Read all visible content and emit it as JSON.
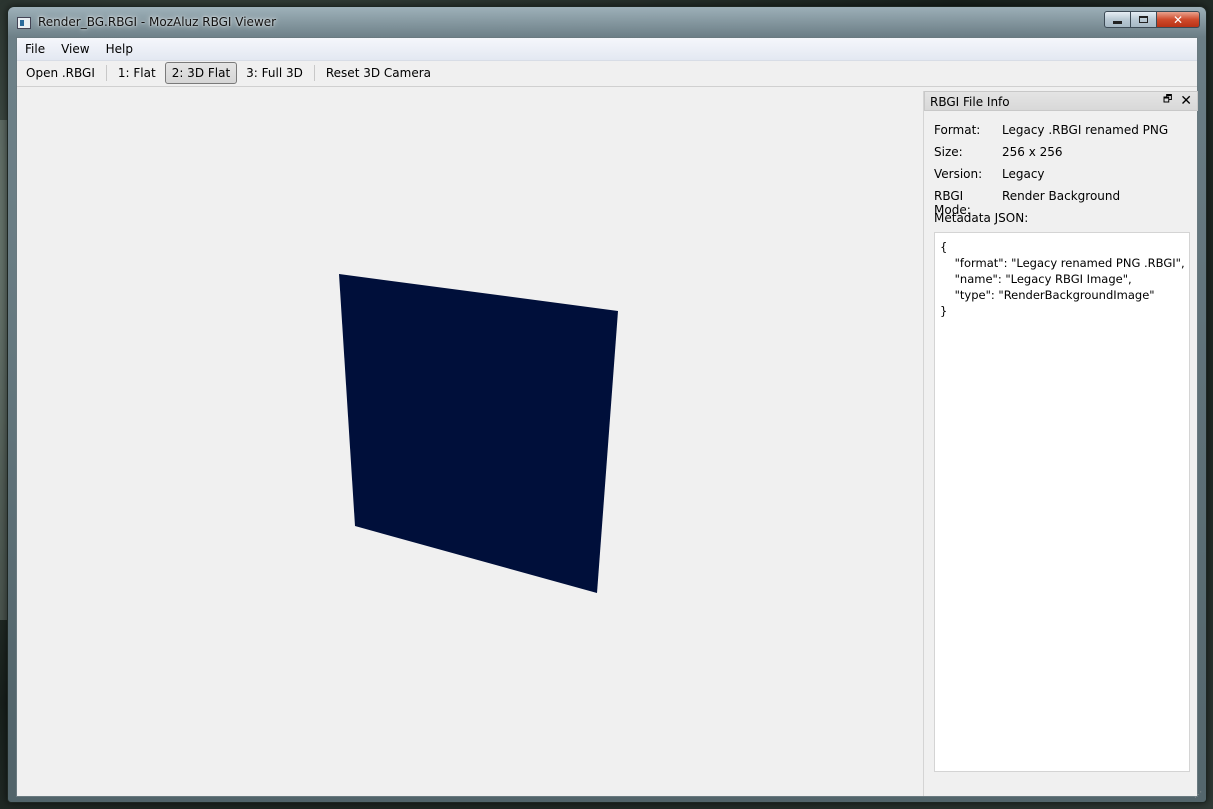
{
  "window": {
    "title": "Render_BG.RBGI - MozAluz RBGI Viewer",
    "close_glyph": "✕"
  },
  "menubar": {
    "items": [
      "File",
      "View",
      "Help"
    ]
  },
  "toolbar": {
    "open": "Open .RBGI",
    "flat": "1: Flat",
    "flat3d": "2: 3D Flat",
    "full3d": "3: Full 3D",
    "reset": "Reset 3D Camera",
    "active_mode": "2: 3D Flat"
  },
  "viewport": {
    "quad_color": "#000f3a",
    "background": "#f0f0f0"
  },
  "dock": {
    "title": "RBGI File Info",
    "float_glyph": "🗗",
    "close_glyph": "✕",
    "rows": [
      {
        "label": "Format:",
        "value": "Legacy .RBGI renamed PNG"
      },
      {
        "label": "Size:",
        "value": "256 x 256"
      },
      {
        "label": "Version:",
        "value": "Legacy"
      },
      {
        "label": "RBGI Mode:",
        "value": "Render Background"
      }
    ],
    "metadata_label": "Metadata JSON:",
    "metadata_json": "{\n    \"format\": \"Legacy renamed PNG .RBGI\",\n    \"name\": \"Legacy RBGI Image\",\n    \"type\": \"RenderBackgroundImage\"\n}"
  }
}
